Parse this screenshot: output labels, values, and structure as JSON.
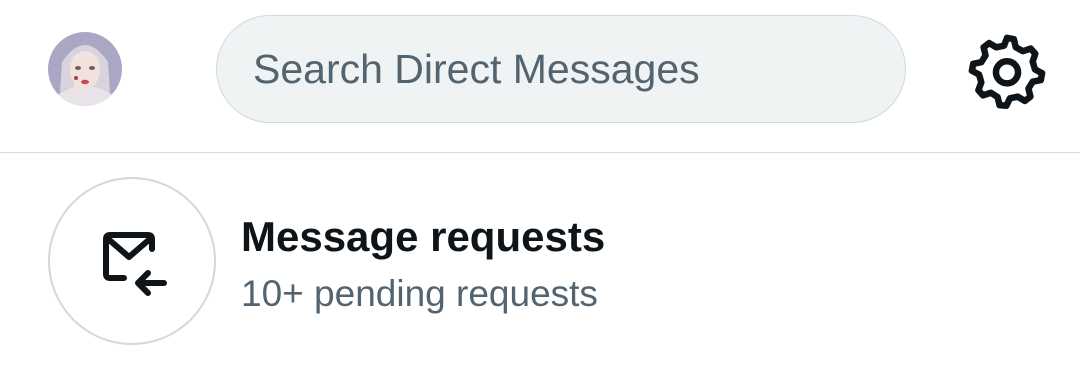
{
  "header": {
    "avatar_icon": "user-avatar",
    "search": {
      "placeholder": "Search Direct Messages",
      "value": ""
    },
    "settings_icon": "gear-icon"
  },
  "message_requests": {
    "icon": "envelope-incoming-icon",
    "title": "Message requests",
    "subtitle": "10+ pending requests"
  },
  "colors": {
    "text_primary": "#0f1419",
    "text_secondary": "#536471",
    "search_bg": "#eff3f4",
    "border": "#cfd9de"
  }
}
